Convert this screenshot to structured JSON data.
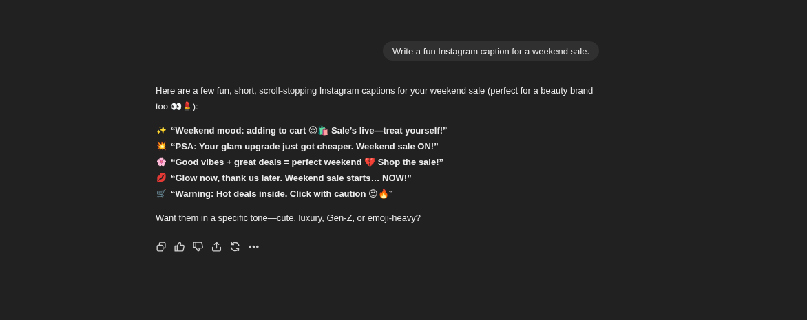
{
  "user_message": {
    "text": "Write a fun Instagram caption for a weekend sale."
  },
  "reply": {
    "intro": "Here are a few fun, short, scroll-stopping Instagram captions for your weekend sale (perfect for a beauty brand too 👀💄):",
    "captions": [
      {
        "emoji": "✨",
        "text": "“Weekend mood: adding to cart 😌🛍️ Sale’s live—treat yourself!”"
      },
      {
        "emoji": "💥",
        "text": "“PSA: Your glam upgrade just got cheaper. Weekend sale ON!”"
      },
      {
        "emoji": "🌸",
        "text": "“Good vibes + great deals = perfect weekend 💔 Shop the sale!”"
      },
      {
        "emoji": "💋",
        "text": "“Glow now, thank us later. Weekend sale starts… NOW!”"
      },
      {
        "emoji": "🛒",
        "text": "“Warning: Hot deals inside. Click with caution 😉🔥”"
      }
    ],
    "outro": "Want them in a specific tone—cute, luxury, Gen-Z, or emoji-heavy?"
  },
  "actions": [
    {
      "kind": "copy"
    },
    {
      "kind": "like"
    },
    {
      "kind": "dislike"
    },
    {
      "kind": "share"
    },
    {
      "kind": "regenerate"
    },
    {
      "kind": "more"
    }
  ]
}
